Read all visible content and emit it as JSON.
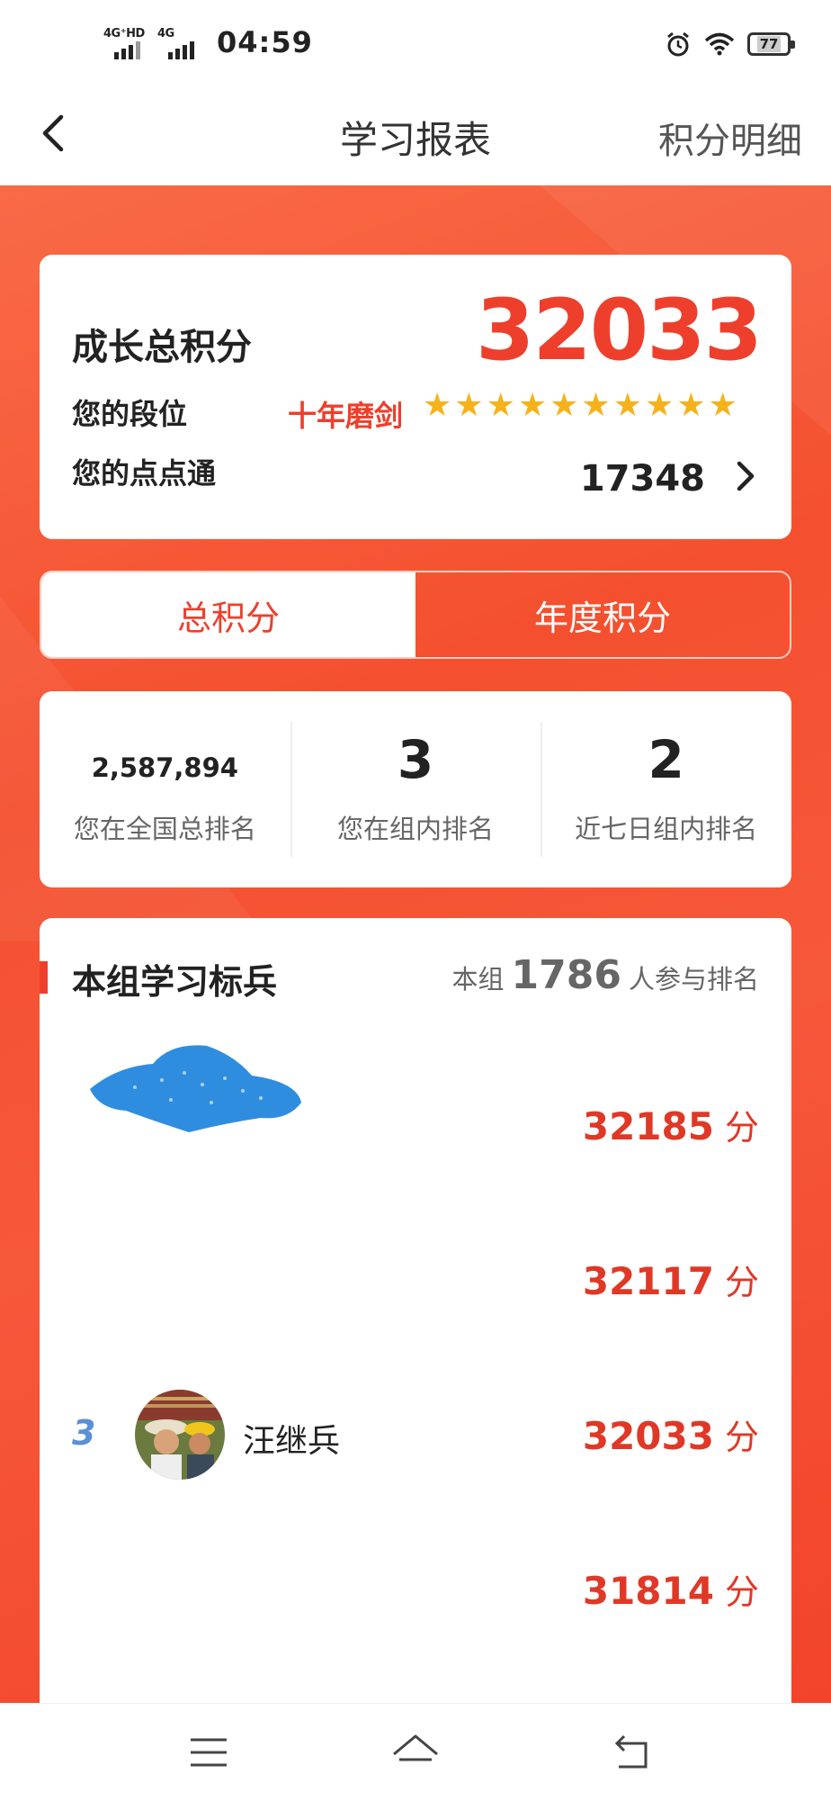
{
  "status_bar": {
    "net1": "4G⁺HD",
    "net2": "4G",
    "time": "04:59",
    "battery": "77",
    "icons": [
      "alarm-icon",
      "wifi-icon",
      "battery-icon"
    ]
  },
  "header": {
    "title": "学习报表",
    "action": "积分明细"
  },
  "score_card": {
    "label": "成长总积分",
    "value": "32033",
    "rank_label": "您的段位",
    "rank_name": "十年磨剑",
    "stars": 10,
    "dd_label": "您的点点通",
    "dd_value": "17348"
  },
  "tabs": [
    {
      "label": "总积分",
      "active": true
    },
    {
      "label": "年度积分",
      "active": false
    }
  ],
  "stats": [
    {
      "value": "2,587,894",
      "label": "您在全国总排名"
    },
    {
      "value": "3",
      "label": "您在组内排名"
    },
    {
      "value": "2",
      "label": "近七日组内排名"
    }
  ],
  "leaderboard": {
    "title": "本组学习标兵",
    "meta_prefix": "本组",
    "meta_count": "1786",
    "meta_suffix": "人参与排名",
    "unit": "分",
    "rows": [
      {
        "rank": "",
        "name": "",
        "score": "32185"
      },
      {
        "rank": "",
        "name": "",
        "score": "32117"
      },
      {
        "rank": "3",
        "name": "汪继兵",
        "score": "32033"
      },
      {
        "rank": "",
        "name": "",
        "score": "31814"
      }
    ]
  },
  "colors": {
    "accent": "#ee3f2c",
    "background_red": "#f4502f",
    "star": "#f6b21b",
    "rank_blue": "#5b8fd6"
  }
}
